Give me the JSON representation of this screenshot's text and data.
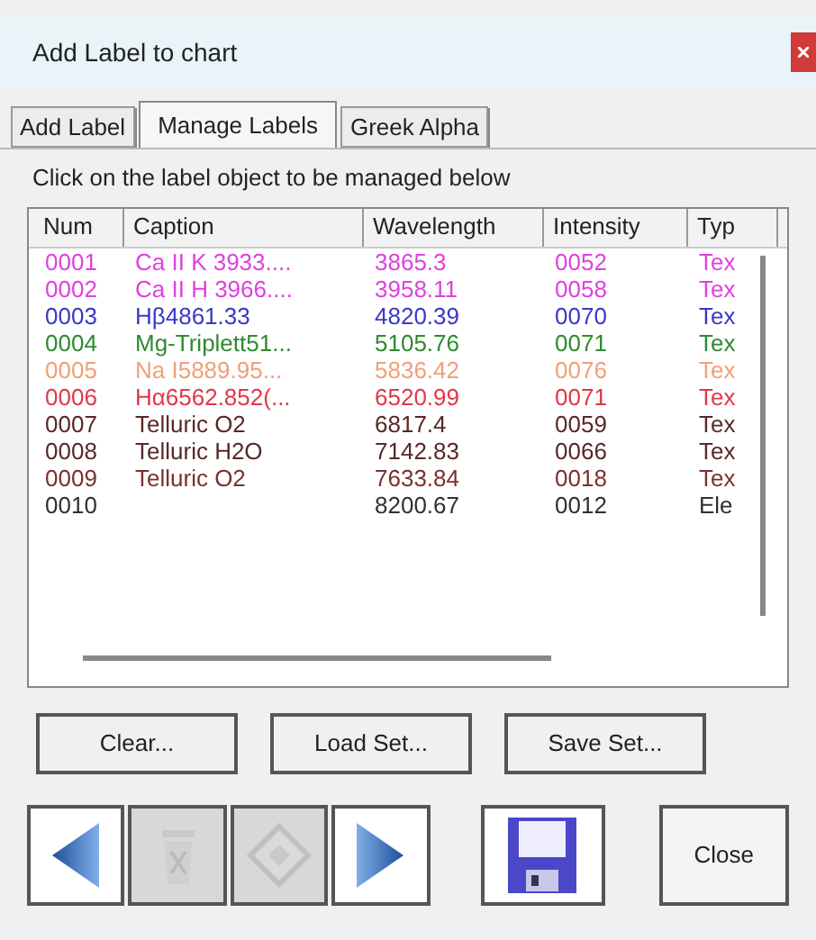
{
  "window": {
    "title": "Add Label to chart"
  },
  "tabs": [
    {
      "label": "Add Label",
      "selected": false
    },
    {
      "label": "Manage Labels",
      "selected": true
    },
    {
      "label": "Greek Alpha",
      "selected": false
    }
  ],
  "instruction": "Click on the label object to be managed below",
  "table": {
    "columns": [
      "Num",
      "Caption",
      "Wavelength",
      "Intensity",
      "Typ"
    ],
    "rows": [
      {
        "color": "#e040e0",
        "cells": [
          "0001",
          "Ca II K 3933....",
          "3865.3",
          "0052",
          "Tex"
        ]
      },
      {
        "color": "#e040e0",
        "cells": [
          "0002",
          "Ca II H 3966....",
          "3958.11",
          "0058",
          "Tex"
        ]
      },
      {
        "color": "#3838c8",
        "cells": [
          "0003",
          "Hβ4861.33",
          "4820.39",
          "0070",
          "Tex"
        ]
      },
      {
        "color": "#2f8a2f",
        "cells": [
          "0004",
          "Mg-Triplett51...",
          "5105.76",
          "0071",
          "Tex"
        ]
      },
      {
        "color": "#f0a078",
        "cells": [
          "0005",
          "Na I5889.95...",
          "5836.42",
          "0076",
          "Tex"
        ]
      },
      {
        "color": "#e03848",
        "cells": [
          "0006",
          "Hα6562.852(...",
          "6520.99",
          "0071",
          "Tex"
        ]
      },
      {
        "color": "#5a2828",
        "cells": [
          "0007",
          "Telluric O2",
          "6817.4",
          "0059",
          "Tex"
        ]
      },
      {
        "color": "#5a2828",
        "cells": [
          "0008",
          "Telluric H2O",
          "7142.83",
          "0066",
          "Tex"
        ]
      },
      {
        "color": "#7a3030",
        "cells": [
          "0009",
          "Telluric O2",
          "7633.84",
          "0018",
          "Tex"
        ]
      },
      {
        "color": "#303030",
        "cells": [
          "0010",
          "",
          "8200.67",
          "0012",
          "Ele"
        ]
      }
    ]
  },
  "buttons": [
    "Clear...",
    "Load Set...",
    "Save Set..."
  ],
  "tools": [
    {
      "kind": "prev",
      "disabled": false
    },
    {
      "kind": "delete",
      "disabled": true
    },
    {
      "kind": "edit",
      "disabled": true
    },
    {
      "kind": "next",
      "disabled": false
    }
  ],
  "save": {
    "kind": "save"
  },
  "close": "Close"
}
